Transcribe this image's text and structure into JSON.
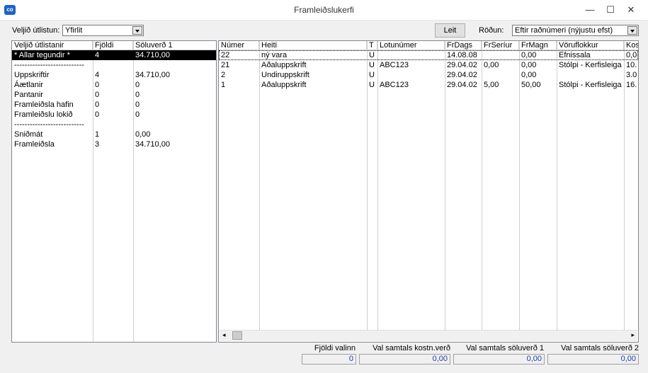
{
  "window": {
    "title": "Framleiðslukerfi",
    "app_icon": "co",
    "minimize": "—",
    "maximize": "☐",
    "close": "✕"
  },
  "toolbar": {
    "view_label": "Veljið útlistun:",
    "view_value": "Yfirlit",
    "search_button": "Leit",
    "sort_label": "Röðun:",
    "sort_value": "Eftir raðnúmeri (nýjustu efst)"
  },
  "left_panel": {
    "columns": [
      "Veljið útlistanir",
      "Fjöldi",
      "Söluverð 1"
    ],
    "rows": [
      [
        "* Allar tegundir *",
        "4",
        "34.710,00"
      ],
      [
        "---------------------------",
        "",
        ""
      ],
      [
        "Uppskriftir",
        "4",
        "34.710,00"
      ],
      [
        "Áætlanir",
        "0",
        "0"
      ],
      [
        "Pantanir",
        "0",
        "0"
      ],
      [
        "Framleiðsla hafin",
        "0",
        "0"
      ],
      [
        "Framleiðslu lokið",
        "0",
        "0"
      ],
      [
        "---------------------------",
        "",
        ""
      ],
      [
        "Sniðmát",
        "1",
        "0,00"
      ],
      [
        "Framleiðsla",
        "3",
        "34.710,00"
      ]
    ]
  },
  "right_panel": {
    "columns": [
      "Númer",
      "Heiti",
      "T",
      "Lotunúmer",
      "FrDags",
      "FrSeríur",
      "FrMagn",
      "Vöruflokkur",
      "Kos"
    ],
    "rows": [
      [
        "22",
        "ný vara",
        "U",
        "",
        "14.08.08",
        "",
        "0,00",
        "Efnissala",
        "0,0"
      ],
      [
        "21",
        "Aðaluppskrift",
        "U",
        "ABC123",
        "29.04.02",
        "0,00",
        "0,00",
        "Stólpi - Kerfisleiga K",
        "10."
      ],
      [
        "2",
        "Undiruppskrift",
        "U",
        "",
        "29.04.02",
        "",
        "0,00",
        "",
        "3.0"
      ],
      [
        "1",
        "Aðaluppskrift",
        "U",
        "ABC123",
        "29.04.02",
        "5,00",
        "50,00",
        "Stólpi - Kerfisleiga K",
        "16."
      ]
    ]
  },
  "footer": {
    "captions": [
      "Fjöldi valinn",
      "Val samtals kostn.verð",
      "Val samtals söluverð 1",
      "Val samtals söluverð 2"
    ],
    "values": [
      "0",
      "0,00",
      "0,00",
      "0,00"
    ]
  }
}
